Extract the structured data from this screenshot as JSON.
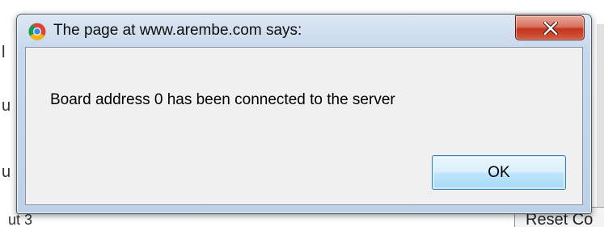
{
  "background": {
    "fragments": [
      "l",
      "u",
      "u",
      "ut 3"
    ],
    "right_button_label": "Reset Co"
  },
  "dialog": {
    "title": "The page at www.arembe.com says:",
    "message": "Board address 0 has been connected to the server",
    "ok_label": "OK",
    "close_glyph": "X",
    "icon": "chrome-icon"
  },
  "colors": {
    "close_button": "#c7402a",
    "ok_border": "#3c7fb1",
    "titlebar": "#c9d9ec"
  }
}
